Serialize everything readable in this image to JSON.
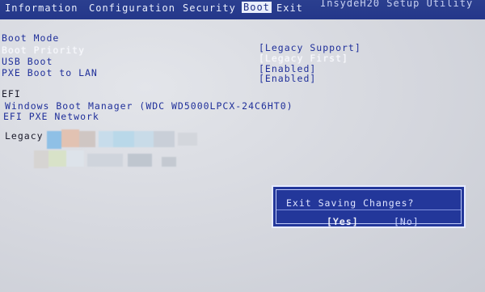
{
  "menubar": {
    "items": [
      {
        "label": "Information"
      },
      {
        "label": "Configuration"
      },
      {
        "label": "Security"
      },
      {
        "label": "Boot"
      },
      {
        "label": "Exit"
      }
    ],
    "active_index": 3,
    "utility_title": "InsydeH20 Setup Utility"
  },
  "boot_settings": {
    "rows": [
      {
        "label": "Boot Mode",
        "value": "[Legacy Support]"
      },
      {
        "label": "Boot Priority",
        "value": "[Legacy First]"
      },
      {
        "label": "USB Boot",
        "value": "[Enabled]"
      },
      {
        "label": "PXE Boot to LAN",
        "value": "[Enabled]"
      }
    ],
    "selected_index": 1
  },
  "efi": {
    "heading": "EFI",
    "items": [
      "Windows Boot Manager (WDC WD5000LPCX-24C6HT0)",
      "EFI PXE Network"
    ]
  },
  "legacy": {
    "heading": "Legacy"
  },
  "dialog": {
    "title": "Exit Saving Changes?",
    "yes_label": "[Yes]",
    "no_label": "[No]"
  },
  "colors": {
    "menubar": "#24378a",
    "text_blue": "#1f2f9a",
    "dialog_bg": "#23379a",
    "screen_bg": "#d5d7de"
  }
}
